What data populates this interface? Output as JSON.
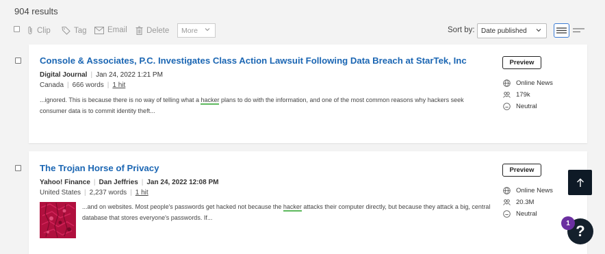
{
  "results": {
    "count_text": "904 results"
  },
  "toolbar": {
    "clip_label": "Clip",
    "tag_label": "Tag",
    "email_label": "Email",
    "delete_label": "Delete",
    "more_label": "More",
    "sort_by_label": "Sort by:",
    "sort_value": "Date published"
  },
  "articles": [
    {
      "title": "Console & Associates, P.C. Investigates Class Action Lawsuit Following Data Breach at StarTek, Inc",
      "source": "Digital Journal",
      "date": "Jan 24, 2022 1:21 PM",
      "country": "Canada",
      "words": "666 words",
      "hits": "1 hit",
      "snippet_before": "...ignored. This is because there is no way of telling what a ",
      "snippet_highlight": "hacker",
      "snippet_after": " plans to do with the information, and one of the most common reasons why hackers seek consumer data is to commit identity theft...",
      "preview_label": "Preview",
      "media_type": "Online News",
      "reach": "179k",
      "sentiment": "Neutral"
    },
    {
      "title": "The Trojan Horse of Privacy",
      "source": "Yahoo! Finance",
      "author": "Dan Jeffries",
      "date": "Jan 24, 2022 12:08 PM",
      "country": "United States",
      "words": "2,237 words",
      "hits": "1 hit",
      "snippet_before": "...and on websites. Most people's passwords get hacked not because the ",
      "snippet_highlight": "hacker",
      "snippet_after": " attacks their computer directly, but because they attack a big, central database that stores everyone's passwords. If...",
      "preview_label": "Preview",
      "media_type": "Online News",
      "reach": "20.3M",
      "sentiment": "Neutral"
    }
  ],
  "help": {
    "badge_count": "1",
    "icon_text": "?"
  },
  "colors": {
    "accent": "#1b66b3",
    "highlight": "#5cb85c",
    "dark_button": "#0e1a26",
    "badge": "#6b2fa0"
  }
}
